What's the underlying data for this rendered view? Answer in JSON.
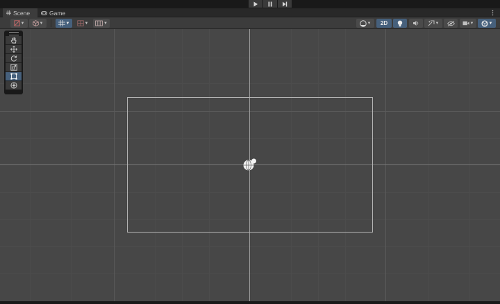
{
  "window": {
    "tabs": [
      {
        "label": "Scene",
        "icon": "grid-icon",
        "active": true
      },
      {
        "label": "Game",
        "icon": "gamepad-icon",
        "active": false
      }
    ]
  },
  "playbar": {
    "buttons": [
      "play-icon",
      "pause-icon",
      "step-icon"
    ]
  },
  "toolbar": {
    "left": [
      "draw-mode-icon",
      "render-mode-cube-icon",
      "grid-snap-icon",
      "increment-snap-icon",
      "view-options-icon"
    ],
    "mode_2d_label": "2D",
    "right": [
      "orientation-sphere-icon",
      "lighting-icon",
      "audio-icon",
      "effects-icon",
      "hidden-objects-icon",
      "camera-icon",
      "gizmos-icon"
    ]
  },
  "tools": [
    "hand-tool-icon",
    "move-tool-icon",
    "rotate-tool-icon",
    "scale-tool-icon",
    "rect-tool-icon",
    "transform-tool-icon"
  ],
  "selected_tool": "rect-tool-icon",
  "colors": {
    "scene_background": "#474747",
    "selected": "#46607c",
    "toolbar": "#3c3c3c",
    "chrome": "#191919"
  }
}
